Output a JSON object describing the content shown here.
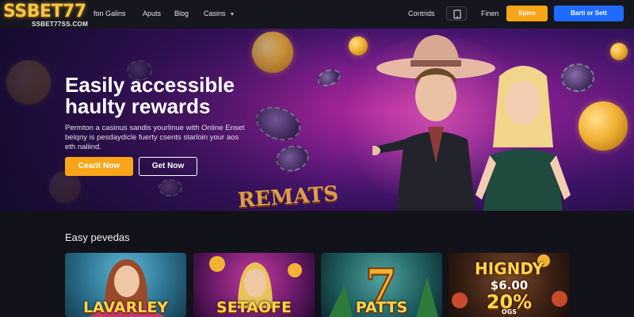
{
  "brand": {
    "name": "SSBET77",
    "domain": "SSBET77SS.COM",
    "color": "#f5c542"
  },
  "nav": {
    "pre_text": "fon Galins",
    "links": [
      "Aputs",
      "Blog",
      "Casins"
    ],
    "right_text_1": "Contrids",
    "right_text_2": "Finen",
    "btn_spins": "Spins",
    "btn_bet": "Barti or Sett",
    "icon": "tablet-icon"
  },
  "hero": {
    "title_line_1": "Easily accessible",
    "title_line_2": "haulty rewards",
    "desc_line_1": "Permton a casinus sandis yourlinue with Online Enset",
    "desc_line_2": "belqny is pesdaydicle fuerty csents starloin your aos",
    "desc_line_3": "eth naliind.",
    "btn_primary": "Cearit Now",
    "btn_secondary": "Get Now",
    "banner_word": "REMATS"
  },
  "section": {
    "title": "Easy pevedas",
    "cards": [
      {
        "title": "LAVARLEY"
      },
      {
        "title": "SETAOFE"
      },
      {
        "title": "PATTS"
      },
      {
        "title": "HIGNDY",
        "amount": "$6.00",
        "percent": "20%",
        "sub": "OGS"
      }
    ]
  },
  "colors": {
    "accent_orange": "#f9a51a",
    "accent_blue": "#1f6bff",
    "bg_dark": "#12131a"
  }
}
